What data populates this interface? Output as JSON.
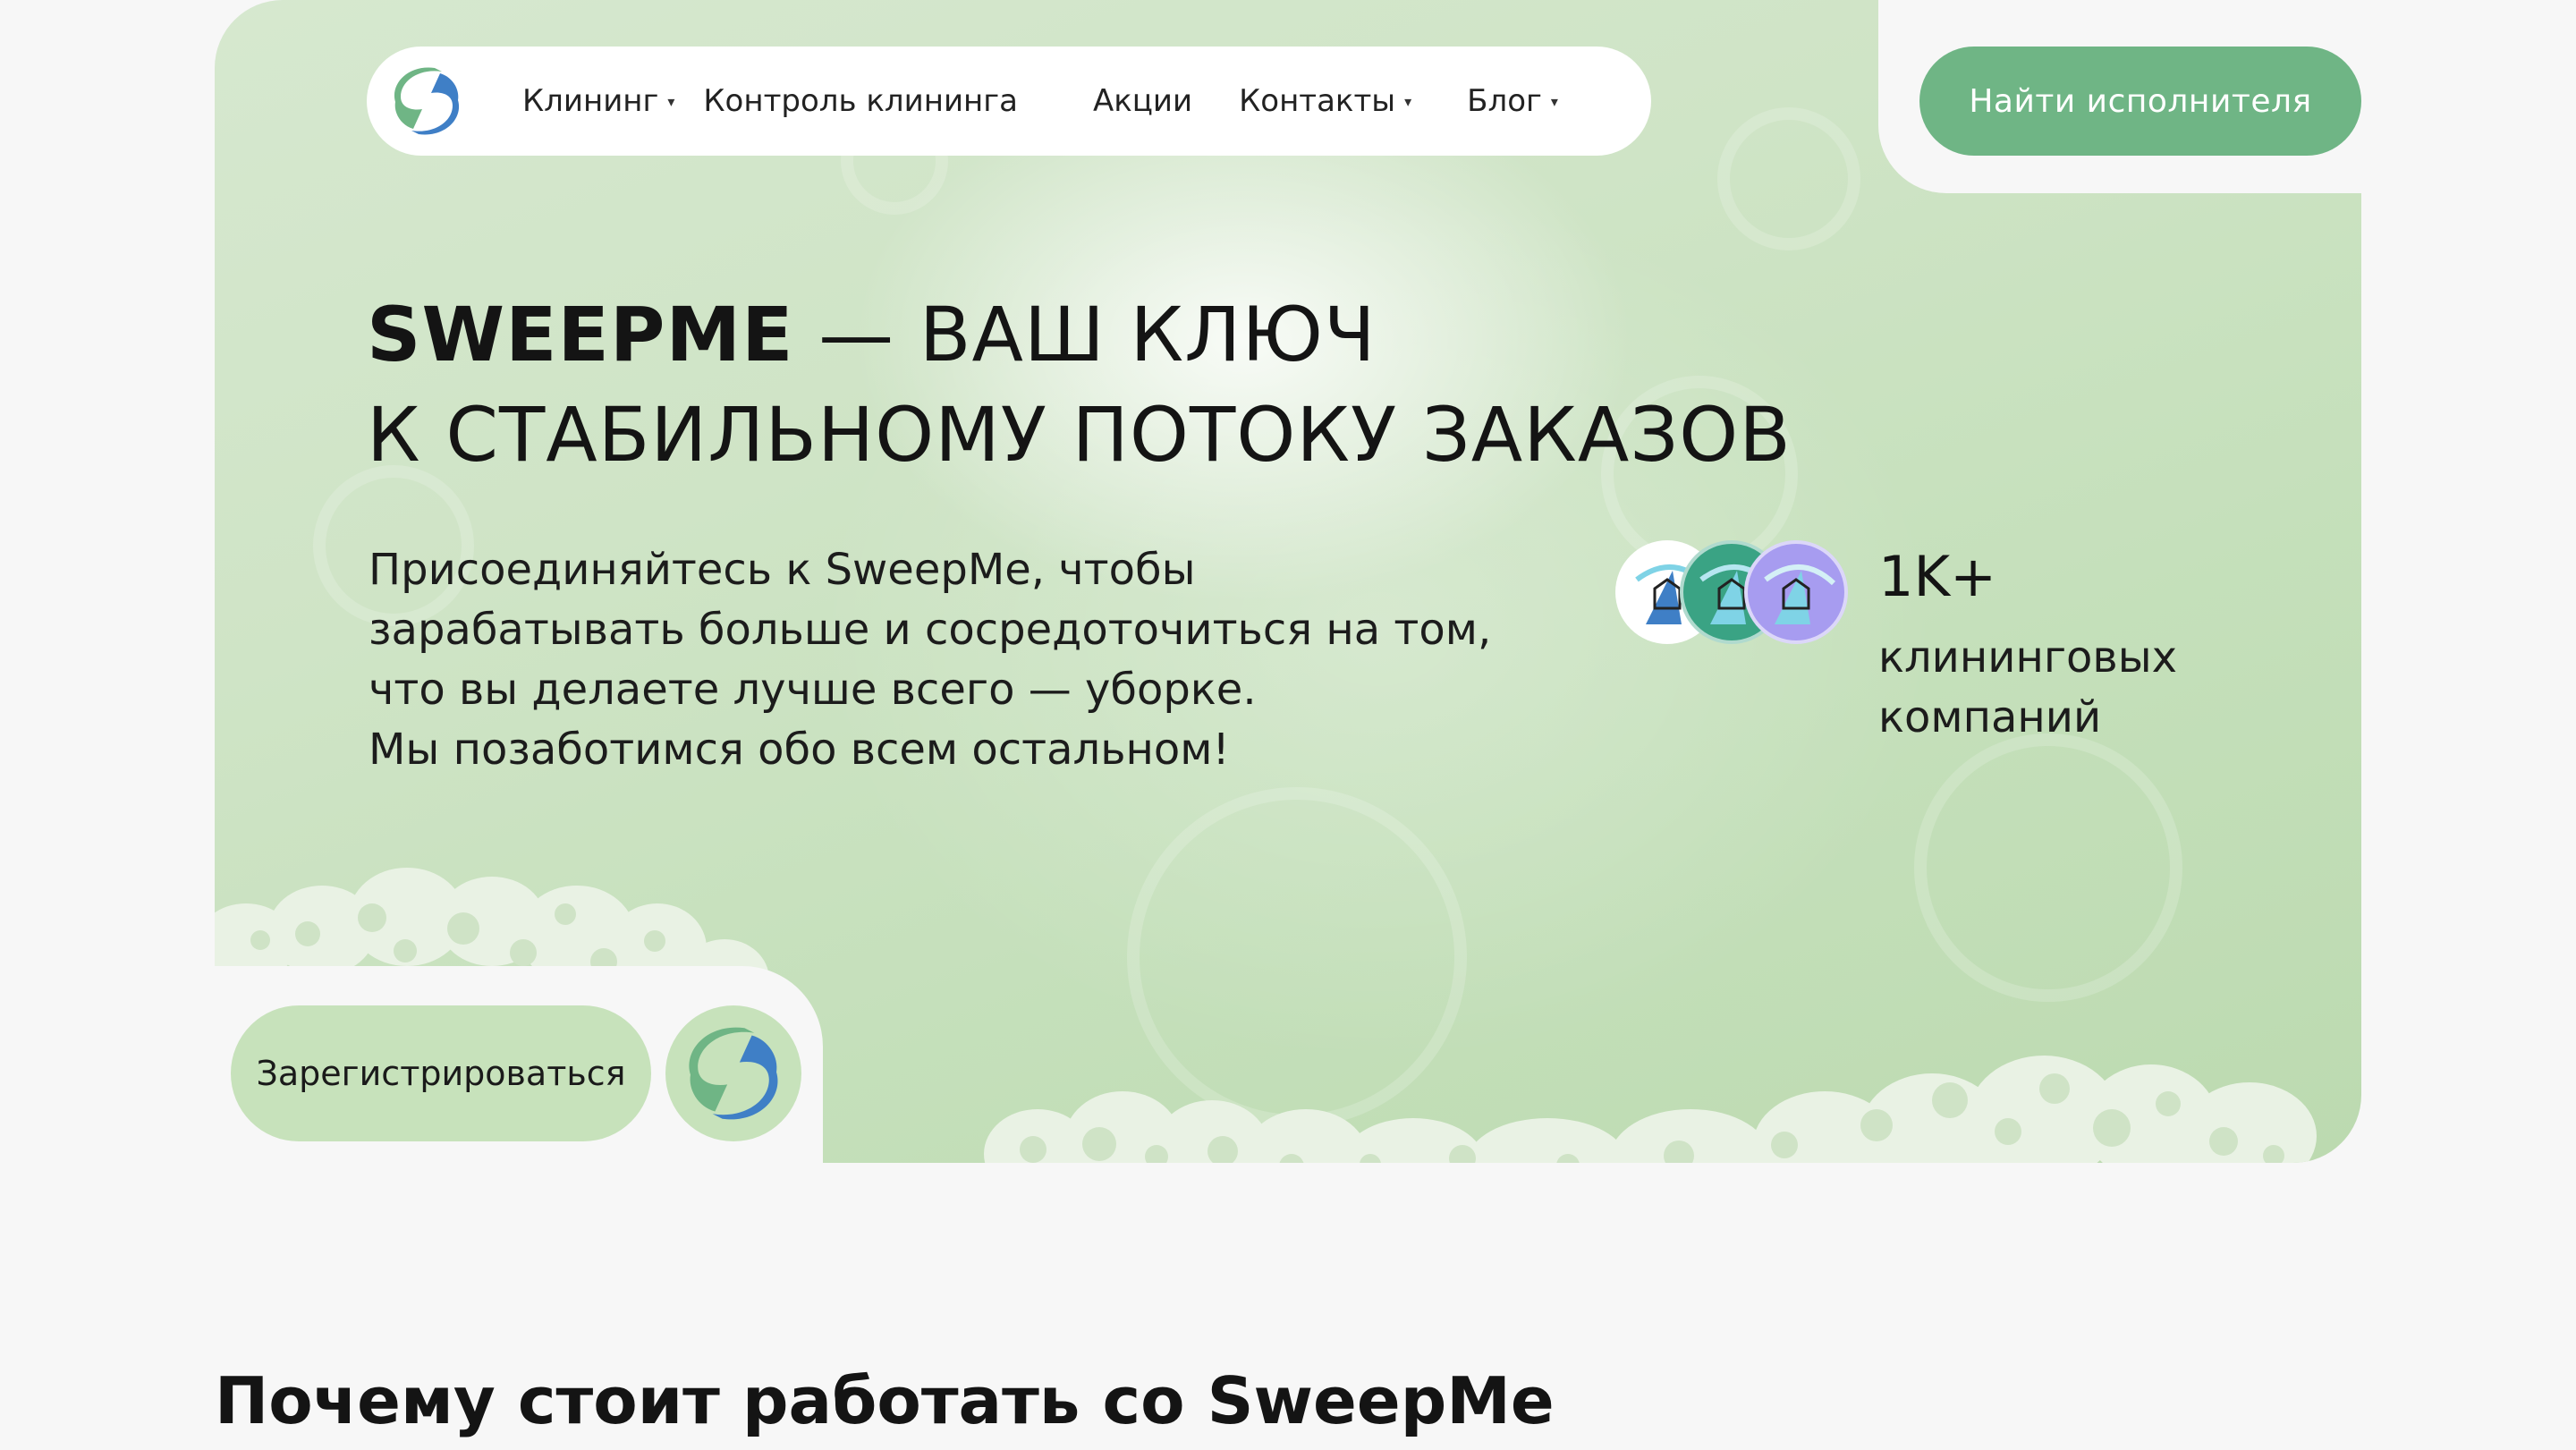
{
  "nav": {
    "items": [
      {
        "label": "Клининг",
        "has_dropdown": true
      },
      {
        "label": "Контроль клининга",
        "has_dropdown": false
      },
      {
        "label": "Акции",
        "has_dropdown": false
      },
      {
        "label": "Контакты",
        "has_dropdown": true
      },
      {
        "label": "Блог",
        "has_dropdown": true
      }
    ],
    "caret": "▾"
  },
  "cta_top": {
    "label": "Найти исполнителя"
  },
  "hero": {
    "brand": "SWEEPME",
    "headline_line1_rest": " — ВАШ КЛЮЧ",
    "headline_line2": "К СТАБИЛЬНОМУ ПОТОКУ ЗАКАЗОВ",
    "subtext_lines": [
      "Присоединяйтесь к SweepMe, чтобы",
      "зарабатывать больше и сосредоточиться на том,",
      "что вы делаете лучше всего — уборке.",
      "Мы позаботимся обо всем остальном!"
    ]
  },
  "stats": {
    "value": "1K+",
    "label_lines": [
      "клининговых",
      "компаний"
    ]
  },
  "register": {
    "label": "Зарегистрироваться"
  },
  "section": {
    "title": "Почему стоит работать со SweepMe"
  },
  "colors": {
    "accent": "#6fb585",
    "hero_bg": "#cfe4c6",
    "button_light": "#c7e2bb",
    "logo_green": "#6fb585",
    "logo_blue": "#3f7fc6"
  }
}
